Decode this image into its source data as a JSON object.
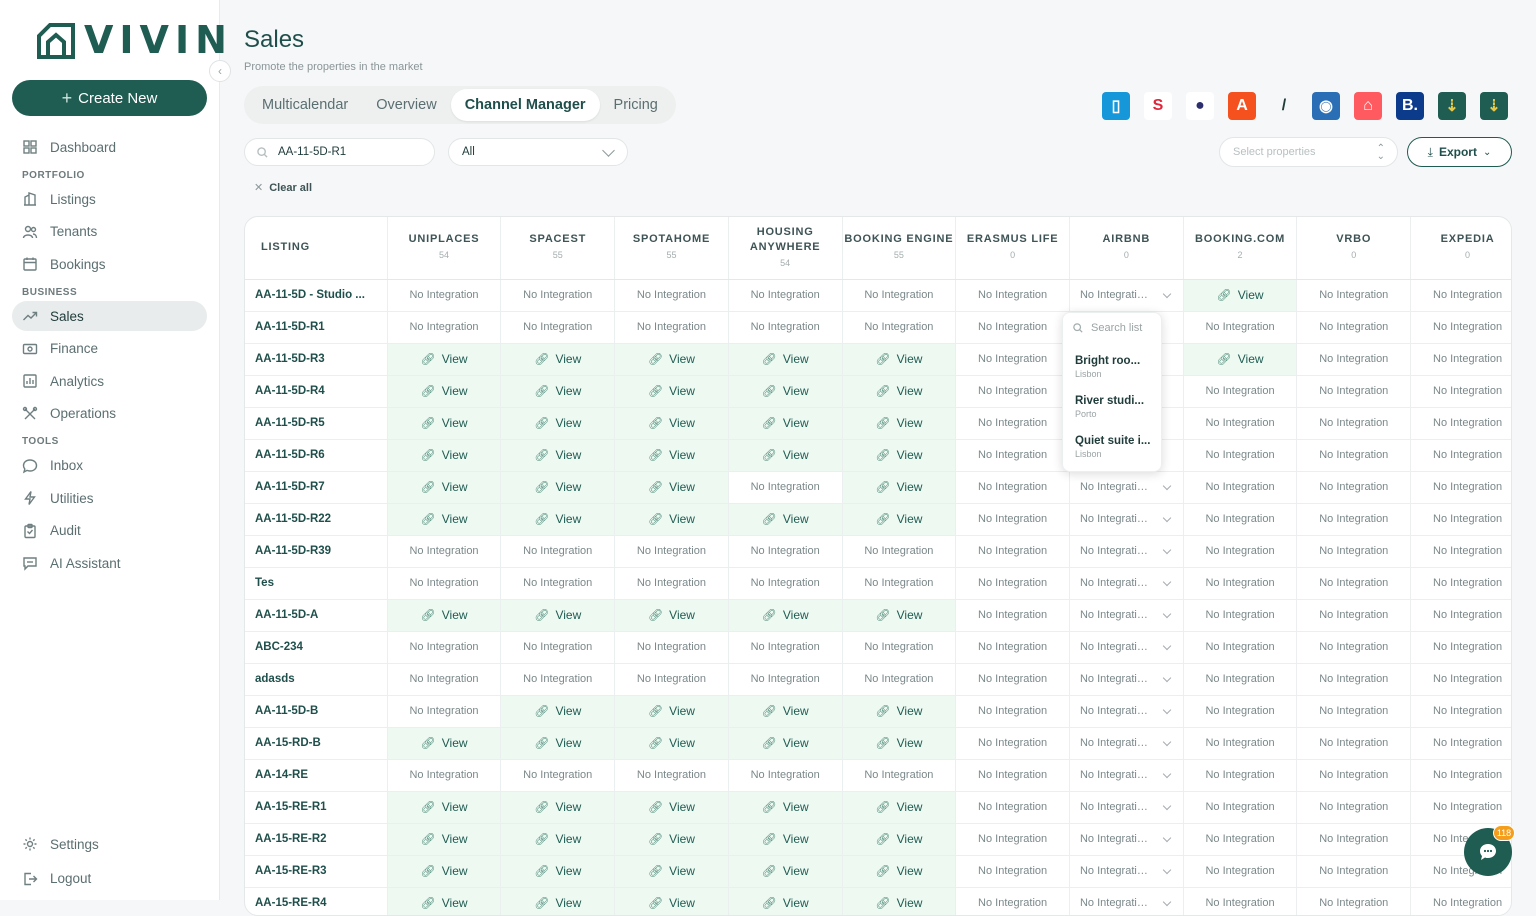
{
  "brand": {
    "name": "VIVIN"
  },
  "sidebar": {
    "create_label": "Create New",
    "sections": [
      {
        "label": "",
        "items": [
          {
            "label": "Dashboard",
            "icon": "grid-icon"
          }
        ]
      },
      {
        "label": "PORTFOLIO",
        "items": [
          {
            "label": "Listings",
            "icon": "building-icon"
          },
          {
            "label": "Tenants",
            "icon": "users-icon"
          },
          {
            "label": "Bookings",
            "icon": "calendar-icon"
          }
        ]
      },
      {
        "label": "BUSINESS",
        "items": [
          {
            "label": "Sales",
            "icon": "trend-icon",
            "active": true
          },
          {
            "label": "Finance",
            "icon": "money-icon"
          },
          {
            "label": "Analytics",
            "icon": "chart-icon"
          },
          {
            "label": "Operations",
            "icon": "tools-icon"
          }
        ]
      },
      {
        "label": "TOOLS",
        "items": [
          {
            "label": "Inbox",
            "icon": "chat-icon"
          },
          {
            "label": "Utilities",
            "icon": "bolt-icon"
          },
          {
            "label": "Audit",
            "icon": "clipboard-icon"
          },
          {
            "label": "AI Assistant",
            "icon": "assistant-icon"
          }
        ]
      }
    ],
    "bottom": [
      {
        "label": "Settings",
        "icon": "gear-icon"
      },
      {
        "label": "Logout",
        "icon": "logout-icon"
      }
    ]
  },
  "header": {
    "title": "Sales",
    "subtitle": "Promote the properties in the market"
  },
  "tabs": [
    {
      "label": "Multicalendar"
    },
    {
      "label": "Overview"
    },
    {
      "label": "Channel Manager",
      "active": true
    },
    {
      "label": "Pricing"
    }
  ],
  "channel_logos": [
    {
      "name": "uniplaces-logo",
      "color": "#1597d9",
      "glyph": "▯",
      "fg": "#ffffff"
    },
    {
      "name": "spacest-logo",
      "color": "#ffffff",
      "glyph": "S",
      "fg": "#e0263b"
    },
    {
      "name": "spotahome-logo",
      "color": "#ffffff",
      "glyph": "●",
      "fg": "#2c2e6e"
    },
    {
      "name": "housing-anywhere-logo",
      "color": "#f4511e",
      "glyph": "A",
      "fg": "#ffffff"
    },
    {
      "name": "booking-engine-logo",
      "color": "transparent",
      "glyph": "/",
      "fg": "#1f3b3a"
    },
    {
      "name": "erasmus-life-logo",
      "color": "#2a6fb5",
      "glyph": "◉",
      "fg": "#ffffff"
    },
    {
      "name": "airbnb-logo",
      "color": "#ff5a5f",
      "glyph": "⌂",
      "fg": "#ffffff"
    },
    {
      "name": "booking-com-logo",
      "color": "#0c3b8c",
      "glyph": "B.",
      "fg": "#ffffff"
    },
    {
      "name": "vrbo-logo",
      "color": "#1f5c52",
      "glyph": "⇣",
      "fg": "#e6c84a"
    },
    {
      "name": "expedia-logo",
      "color": "#1f5c52",
      "glyph": "⇣",
      "fg": "#e6c84a"
    }
  ],
  "search": {
    "value": "AA-11-5D-R1"
  },
  "filter": {
    "selected": "All"
  },
  "clear_all": "Clear all",
  "select_properties": {
    "placeholder": "Select properties"
  },
  "export_label": "Export",
  "table": {
    "listing_header": "LISTING",
    "columns": [
      {
        "label": "UNIPLACES",
        "count": "54"
      },
      {
        "label": "SPACEST",
        "count": "55"
      },
      {
        "label": "SPOTAHOME",
        "count": "55"
      },
      {
        "label": "HOUSING ANYWHERE",
        "count": "54"
      },
      {
        "label": "BOOKING ENGINE",
        "count": "55"
      },
      {
        "label": "ERASMUS LIFE",
        "count": "0"
      },
      {
        "label": "AIRBNB",
        "count": "0"
      },
      {
        "label": "BOOKING.COM",
        "count": "2"
      },
      {
        "label": "VRBO",
        "count": "0"
      },
      {
        "label": "EXPEDIA",
        "count": "0"
      }
    ],
    "no_integration": "No Integration",
    "view_label": "View",
    "airbnb_placeholder": "No Integrati…",
    "rows": [
      {
        "name": "AA-11-5D - Studio ...",
        "cells": [
          0,
          0,
          0,
          0,
          0,
          0,
          2,
          1,
          0,
          0
        ]
      },
      {
        "name": "AA-11-5D-R1",
        "cells": [
          0,
          0,
          0,
          0,
          0,
          0,
          3,
          0,
          0,
          0
        ]
      },
      {
        "name": "AA-11-5D-R3",
        "cells": [
          1,
          1,
          1,
          1,
          1,
          0,
          3,
          1,
          0,
          0
        ]
      },
      {
        "name": "AA-11-5D-R4",
        "cells": [
          1,
          1,
          1,
          1,
          1,
          0,
          3,
          0,
          0,
          0
        ]
      },
      {
        "name": "AA-11-5D-R5",
        "cells": [
          1,
          1,
          1,
          1,
          1,
          0,
          3,
          0,
          0,
          0
        ]
      },
      {
        "name": "AA-11-5D-R6",
        "cells": [
          1,
          1,
          1,
          1,
          1,
          0,
          3,
          0,
          0,
          0
        ]
      },
      {
        "name": "AA-11-5D-R7",
        "cells": [
          1,
          1,
          1,
          0,
          1,
          0,
          2,
          0,
          0,
          0
        ]
      },
      {
        "name": "AA-11-5D-R22",
        "cells": [
          1,
          1,
          1,
          1,
          1,
          0,
          2,
          0,
          0,
          0
        ]
      },
      {
        "name": "AA-11-5D-R39",
        "cells": [
          0,
          0,
          0,
          0,
          0,
          0,
          2,
          0,
          0,
          0
        ]
      },
      {
        "name": "Tes",
        "cells": [
          0,
          0,
          0,
          0,
          0,
          0,
          2,
          0,
          0,
          0
        ]
      },
      {
        "name": "AA-11-5D-A",
        "cells": [
          1,
          1,
          1,
          1,
          1,
          0,
          2,
          0,
          0,
          0
        ]
      },
      {
        "name": "ABC-234",
        "cells": [
          0,
          0,
          0,
          0,
          0,
          0,
          2,
          0,
          0,
          0
        ]
      },
      {
        "name": "adasds",
        "cells": [
          0,
          0,
          0,
          0,
          0,
          0,
          2,
          0,
          0,
          0
        ]
      },
      {
        "name": "AA-11-5D-B",
        "cells": [
          0,
          1,
          1,
          1,
          1,
          0,
          2,
          0,
          0,
          0
        ]
      },
      {
        "name": "AA-15-RD-B",
        "cells": [
          1,
          1,
          1,
          1,
          1,
          0,
          2,
          0,
          0,
          0
        ]
      },
      {
        "name": "AA-14-RE",
        "cells": [
          0,
          0,
          0,
          0,
          0,
          0,
          2,
          0,
          0,
          0
        ]
      },
      {
        "name": "AA-15-RE-R1",
        "cells": [
          1,
          1,
          1,
          1,
          1,
          0,
          2,
          0,
          0,
          0
        ]
      },
      {
        "name": "AA-15-RE-R2",
        "cells": [
          1,
          1,
          1,
          1,
          1,
          0,
          2,
          0,
          0,
          0
        ]
      },
      {
        "name": "AA-15-RE-R3",
        "cells": [
          1,
          1,
          1,
          1,
          1,
          0,
          2,
          0,
          0,
          0
        ]
      },
      {
        "name": "AA-15-RE-R4",
        "cells": [
          1,
          1,
          1,
          1,
          1,
          0,
          2,
          0,
          0,
          0
        ]
      }
    ]
  },
  "dropdown": {
    "search_placeholder": "Search list",
    "items": [
      {
        "title": "Bright roo...",
        "subtitle": "Lisbon"
      },
      {
        "title": "River studi...",
        "subtitle": "Porto"
      },
      {
        "title": "Quiet suite i...",
        "subtitle": "Lisbon"
      }
    ]
  },
  "chat": {
    "badge": "118"
  }
}
